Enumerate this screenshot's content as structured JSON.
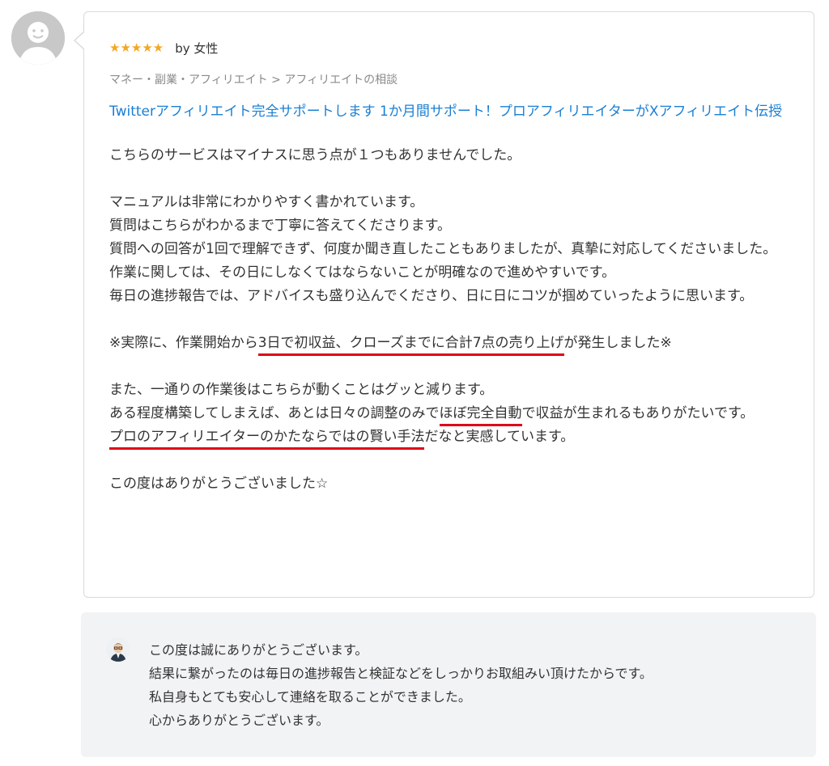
{
  "review": {
    "rating_stars": "★★★★★",
    "rating": 5,
    "by_label": "by 女性",
    "breadcrumb": "マネー・副業・アフィリエイト > アフィリエイトの相談",
    "service_title": "Twitterアフィリエイト完全サポートします 1か月間サポート！プロアフィリエイターがXアフィリエイト伝授",
    "body": {
      "line1": "こちらのサービスはマイナスに思う点が１つもありませんでした。",
      "para2": "マニュアルは非常にわかりやすく書かれています。\n質問はこちらがわかるまで丁寧に答えてくださります。\n質問への回答が1回で理解できず、何度か聞き直したこともありましたが、真摯に対応してくださいました。\n作業に関しては、その日にしなくてはならないことが明確なので進めやすいです。\n毎日の進捗報告では、アドバイスも盛り込んでくださり、日に日にコツが掴めていったように思います。",
      "para3_pre": "※実際に、作業開始から",
      "para3_hl": "3日で初収益、クローズまでに合計7点の売り上げ",
      "para3_post": "が発生しました※",
      "para4_line1": "また、一通りの作業後はこちらが動くことはグッと減ります。",
      "para4_pre": "ある程度構築してしまえば、あとは日々の調整のみで",
      "para4_hl": "ほぼ完全自動",
      "para4_post": "で収益が生まれるもありがたいです。",
      "para5_hl": "プロのアフィリエイターのかたならではの賢い手法",
      "para5_post": "だなと実感しています。",
      "closing": "この度はありがとうございました☆"
    }
  },
  "reply": {
    "lines": [
      "この度は誠にありがとうございます。",
      "結果に繋がったのは毎日の進捗報告と検証などをしっかりお取組みい頂けたからです。",
      "私自身もとても安心して連絡を取ることができました。",
      "心からありがとうございます。"
    ]
  },
  "colors": {
    "link": "#1a7fd4",
    "star": "#f5a623",
    "highlight_underline": "#e0001a",
    "reply_bg": "#f2f3f5"
  },
  "icons": {
    "reviewer_avatar": "default-user-avatar-icon",
    "seller_avatar": "seller-avatar-icon"
  }
}
